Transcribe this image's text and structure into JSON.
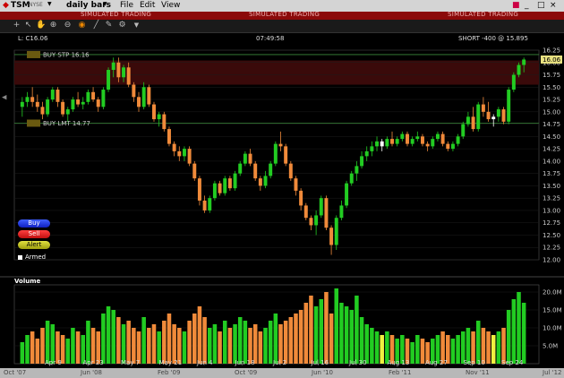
{
  "window": {
    "symbol": "TSM",
    "exchange": "NYSE",
    "timeframe": "daily bars",
    "menu": [
      "File",
      "Edit",
      "View"
    ],
    "sim_text": "SIMULATED TRADING"
  },
  "info": {
    "last": "L: C16.06",
    "time": "07:49:58",
    "position": "SHORT -400 @ 15.895"
  },
  "orders": {
    "buy_stop": "BUY STP 16.16",
    "buy_lmt": "BUY LMT 14.77",
    "current_price": "16.06"
  },
  "buttons": {
    "buy": "Buy",
    "sell": "Sell",
    "alert": "Alert",
    "armed": "Armed"
  },
  "volume": {
    "label": "Volume"
  },
  "colors": {
    "up": "#22cc22",
    "down": "#f08a3a",
    "neutral": "#ffffff",
    "sim": "#8b0a0a",
    "price_tag": "#e8e080"
  },
  "price_axis": [
    "16.25",
    "16.00",
    "15.75",
    "15.50",
    "15.25",
    "15.00",
    "14.75",
    "14.50",
    "14.25",
    "14.00",
    "13.75",
    "13.50",
    "13.25",
    "13.00",
    "12.75",
    "12.50",
    "12.25",
    "12.00"
  ],
  "volume_axis": [
    "20.0M",
    "15.0M",
    "10.0M",
    "5.0M"
  ],
  "date_axis": [
    "Apr 9",
    "Apr 23",
    "May 7",
    "May 21",
    "Jun 4",
    "Jun 18",
    "Jul 2",
    "Jul 16",
    "Jul 30",
    "Aug 13",
    "Aug 27",
    "Sep 10",
    "Sep 24"
  ],
  "bottom_axis": [
    "Oct '07",
    "Jun '08",
    "Feb '09",
    "Oct '09",
    "Jun '10",
    "Feb '11",
    "Nov '11",
    "Jul '12"
  ],
  "chart_data": {
    "type": "candlestick",
    "ylim": [
      12.0,
      16.25
    ],
    "volume_ylim": [
      0,
      22
    ],
    "candles": [
      [
        15.1,
        15.3,
        14.9,
        15.2,
        "u",
        6
      ],
      [
        15.2,
        15.4,
        15.1,
        15.3,
        "u",
        8
      ],
      [
        15.3,
        15.5,
        15.1,
        15.2,
        "d",
        9
      ],
      [
        15.2,
        15.35,
        15.0,
        15.1,
        "d",
        7
      ],
      [
        15.1,
        15.2,
        14.85,
        14.95,
        "d",
        10
      ],
      [
        14.95,
        15.3,
        14.9,
        15.25,
        "u",
        12
      ],
      [
        15.25,
        15.5,
        15.2,
        15.45,
        "u",
        11
      ],
      [
        15.45,
        15.5,
        15.1,
        15.2,
        "d",
        9
      ],
      [
        15.2,
        15.25,
        14.9,
        14.95,
        "d",
        8
      ],
      [
        14.95,
        15.1,
        14.8,
        15.05,
        "u",
        7
      ],
      [
        15.05,
        15.3,
        15.0,
        15.25,
        "u",
        10
      ],
      [
        15.25,
        15.4,
        15.1,
        15.15,
        "d",
        9
      ],
      [
        15.15,
        15.3,
        15.05,
        15.2,
        "u",
        8
      ],
      [
        15.2,
        15.45,
        15.15,
        15.4,
        "u",
        12
      ],
      [
        15.4,
        15.5,
        15.2,
        15.25,
        "d",
        10
      ],
      [
        15.25,
        15.3,
        15.0,
        15.1,
        "d",
        9
      ],
      [
        15.1,
        15.5,
        15.05,
        15.45,
        "u",
        14
      ],
      [
        15.45,
        15.9,
        15.4,
        15.85,
        "u",
        16
      ],
      [
        15.85,
        16.1,
        15.7,
        16.0,
        "u",
        15
      ],
      [
        16.0,
        16.1,
        15.6,
        15.7,
        "d",
        13
      ],
      [
        15.7,
        15.95,
        15.6,
        15.9,
        "u",
        11
      ],
      [
        15.9,
        16.0,
        15.5,
        15.55,
        "d",
        12
      ],
      [
        15.55,
        15.6,
        15.2,
        15.3,
        "d",
        10
      ],
      [
        15.3,
        15.4,
        15.0,
        15.1,
        "d",
        9
      ],
      [
        15.1,
        15.6,
        15.05,
        15.5,
        "u",
        13
      ],
      [
        15.5,
        15.55,
        15.1,
        15.15,
        "d",
        10
      ],
      [
        15.15,
        15.2,
        14.8,
        14.85,
        "d",
        11
      ],
      [
        14.85,
        15.0,
        14.7,
        14.95,
        "u",
        9
      ],
      [
        14.95,
        15.0,
        14.6,
        14.65,
        "d",
        12
      ],
      [
        14.65,
        14.7,
        14.3,
        14.35,
        "d",
        14
      ],
      [
        14.35,
        14.4,
        14.1,
        14.2,
        "d",
        11
      ],
      [
        14.2,
        14.3,
        14.0,
        14.1,
        "d",
        10
      ],
      [
        14.1,
        14.3,
        14.0,
        14.25,
        "u",
        9
      ],
      [
        14.25,
        14.3,
        13.9,
        13.95,
        "d",
        12
      ],
      [
        13.95,
        14.0,
        13.6,
        13.65,
        "d",
        14
      ],
      [
        13.65,
        13.7,
        13.1,
        13.2,
        "d",
        16
      ],
      [
        13.2,
        13.3,
        12.95,
        13.0,
        "d",
        13
      ],
      [
        13.0,
        13.3,
        12.95,
        13.25,
        "u",
        10
      ],
      [
        13.25,
        13.6,
        13.2,
        13.55,
        "u",
        11
      ],
      [
        13.55,
        13.6,
        13.3,
        13.35,
        "d",
        9
      ],
      [
        13.35,
        13.7,
        13.3,
        13.65,
        "u",
        12
      ],
      [
        13.65,
        13.7,
        13.4,
        13.45,
        "d",
        10
      ],
      [
        13.45,
        13.8,
        13.4,
        13.75,
        "u",
        11
      ],
      [
        13.75,
        14.0,
        13.7,
        13.95,
        "u",
        13
      ],
      [
        13.95,
        14.2,
        13.9,
        14.15,
        "u",
        12
      ],
      [
        14.15,
        14.25,
        13.9,
        13.95,
        "d",
        10
      ],
      [
        13.95,
        14.0,
        13.6,
        13.65,
        "d",
        11
      ],
      [
        13.65,
        13.7,
        13.4,
        13.5,
        "d",
        9
      ],
      [
        13.5,
        13.8,
        13.45,
        13.7,
        "u",
        10
      ],
      [
        13.7,
        14.0,
        13.65,
        13.95,
        "u",
        12
      ],
      [
        13.95,
        14.4,
        13.9,
        14.35,
        "u",
        14
      ],
      [
        14.35,
        14.6,
        14.2,
        14.3,
        "d",
        11
      ],
      [
        14.3,
        14.35,
        13.9,
        13.95,
        "d",
        12
      ],
      [
        13.95,
        14.0,
        13.6,
        13.65,
        "d",
        13
      ],
      [
        13.65,
        13.7,
        13.3,
        13.4,
        "d",
        14
      ],
      [
        13.4,
        13.45,
        13.0,
        13.1,
        "d",
        15
      ],
      [
        13.1,
        13.15,
        12.8,
        12.85,
        "d",
        17
      ],
      [
        12.85,
        12.9,
        12.6,
        12.7,
        "d",
        19
      ],
      [
        12.7,
        13.0,
        12.5,
        12.9,
        "u",
        16
      ],
      [
        12.9,
        13.3,
        12.85,
        13.25,
        "u",
        18
      ],
      [
        13.25,
        13.3,
        12.6,
        12.65,
        "d",
        20
      ],
      [
        12.65,
        12.7,
        12.1,
        12.3,
        "d",
        14
      ],
      [
        12.3,
        12.9,
        12.2,
        12.85,
        "u",
        21
      ],
      [
        12.85,
        13.2,
        12.8,
        13.1,
        "u",
        17
      ],
      [
        13.1,
        13.6,
        13.05,
        13.55,
        "u",
        16
      ],
      [
        13.55,
        13.8,
        13.5,
        13.75,
        "u",
        15
      ],
      [
        13.75,
        14.0,
        13.6,
        13.9,
        "u",
        19
      ],
      [
        13.9,
        14.2,
        13.85,
        14.1,
        "u",
        13
      ],
      [
        14.1,
        14.3,
        14.0,
        14.2,
        "u",
        11
      ],
      [
        14.2,
        14.4,
        14.1,
        14.3,
        "u",
        10
      ],
      [
        14.3,
        14.5,
        14.2,
        14.4,
        "u",
        9
      ],
      [
        14.4,
        14.45,
        14.2,
        14.3,
        "n",
        8
      ],
      [
        14.3,
        14.5,
        14.25,
        14.45,
        "u",
        9
      ],
      [
        14.45,
        14.6,
        14.3,
        14.35,
        "d",
        8
      ],
      [
        14.35,
        14.5,
        14.3,
        14.45,
        "u",
        7
      ],
      [
        14.45,
        14.6,
        14.4,
        14.55,
        "u",
        8
      ],
      [
        14.55,
        14.6,
        14.3,
        14.35,
        "d",
        7
      ],
      [
        14.35,
        14.5,
        14.3,
        14.45,
        "u",
        6
      ],
      [
        14.45,
        14.6,
        14.4,
        14.5,
        "u",
        8
      ],
      [
        14.5,
        14.55,
        14.3,
        14.35,
        "d",
        7
      ],
      [
        14.35,
        14.4,
        14.2,
        14.3,
        "d",
        6
      ],
      [
        14.3,
        14.5,
        14.25,
        14.45,
        "u",
        7
      ],
      [
        14.45,
        14.6,
        14.4,
        14.55,
        "u",
        8
      ],
      [
        14.55,
        14.6,
        14.3,
        14.35,
        "d",
        9
      ],
      [
        14.35,
        14.4,
        14.2,
        14.25,
        "d",
        8
      ],
      [
        14.25,
        14.4,
        14.2,
        14.35,
        "u",
        7
      ],
      [
        14.35,
        14.55,
        14.3,
        14.5,
        "u",
        8
      ],
      [
        14.5,
        14.8,
        14.45,
        14.75,
        "u",
        9
      ],
      [
        14.75,
        15.0,
        14.7,
        14.9,
        "u",
        10
      ],
      [
        14.9,
        15.1,
        14.6,
        14.65,
        "d",
        9
      ],
      [
        14.65,
        15.2,
        14.6,
        15.15,
        "u",
        12
      ],
      [
        15.15,
        15.3,
        14.9,
        15.0,
        "d",
        10
      ],
      [
        15.0,
        15.2,
        14.8,
        14.85,
        "d",
        9
      ],
      [
        14.85,
        14.95,
        14.7,
        14.9,
        "n",
        8
      ],
      [
        14.9,
        15.1,
        14.8,
        15.05,
        "u",
        9
      ],
      [
        15.05,
        15.1,
        14.75,
        14.8,
        "d",
        10
      ],
      [
        14.8,
        15.5,
        14.75,
        15.45,
        "u",
        15
      ],
      [
        15.45,
        15.8,
        15.4,
        15.75,
        "u",
        18
      ],
      [
        15.75,
        16.0,
        15.7,
        15.95,
        "u",
        20
      ],
      [
        15.95,
        16.1,
        15.8,
        16.06,
        "u",
        17
      ]
    ]
  }
}
